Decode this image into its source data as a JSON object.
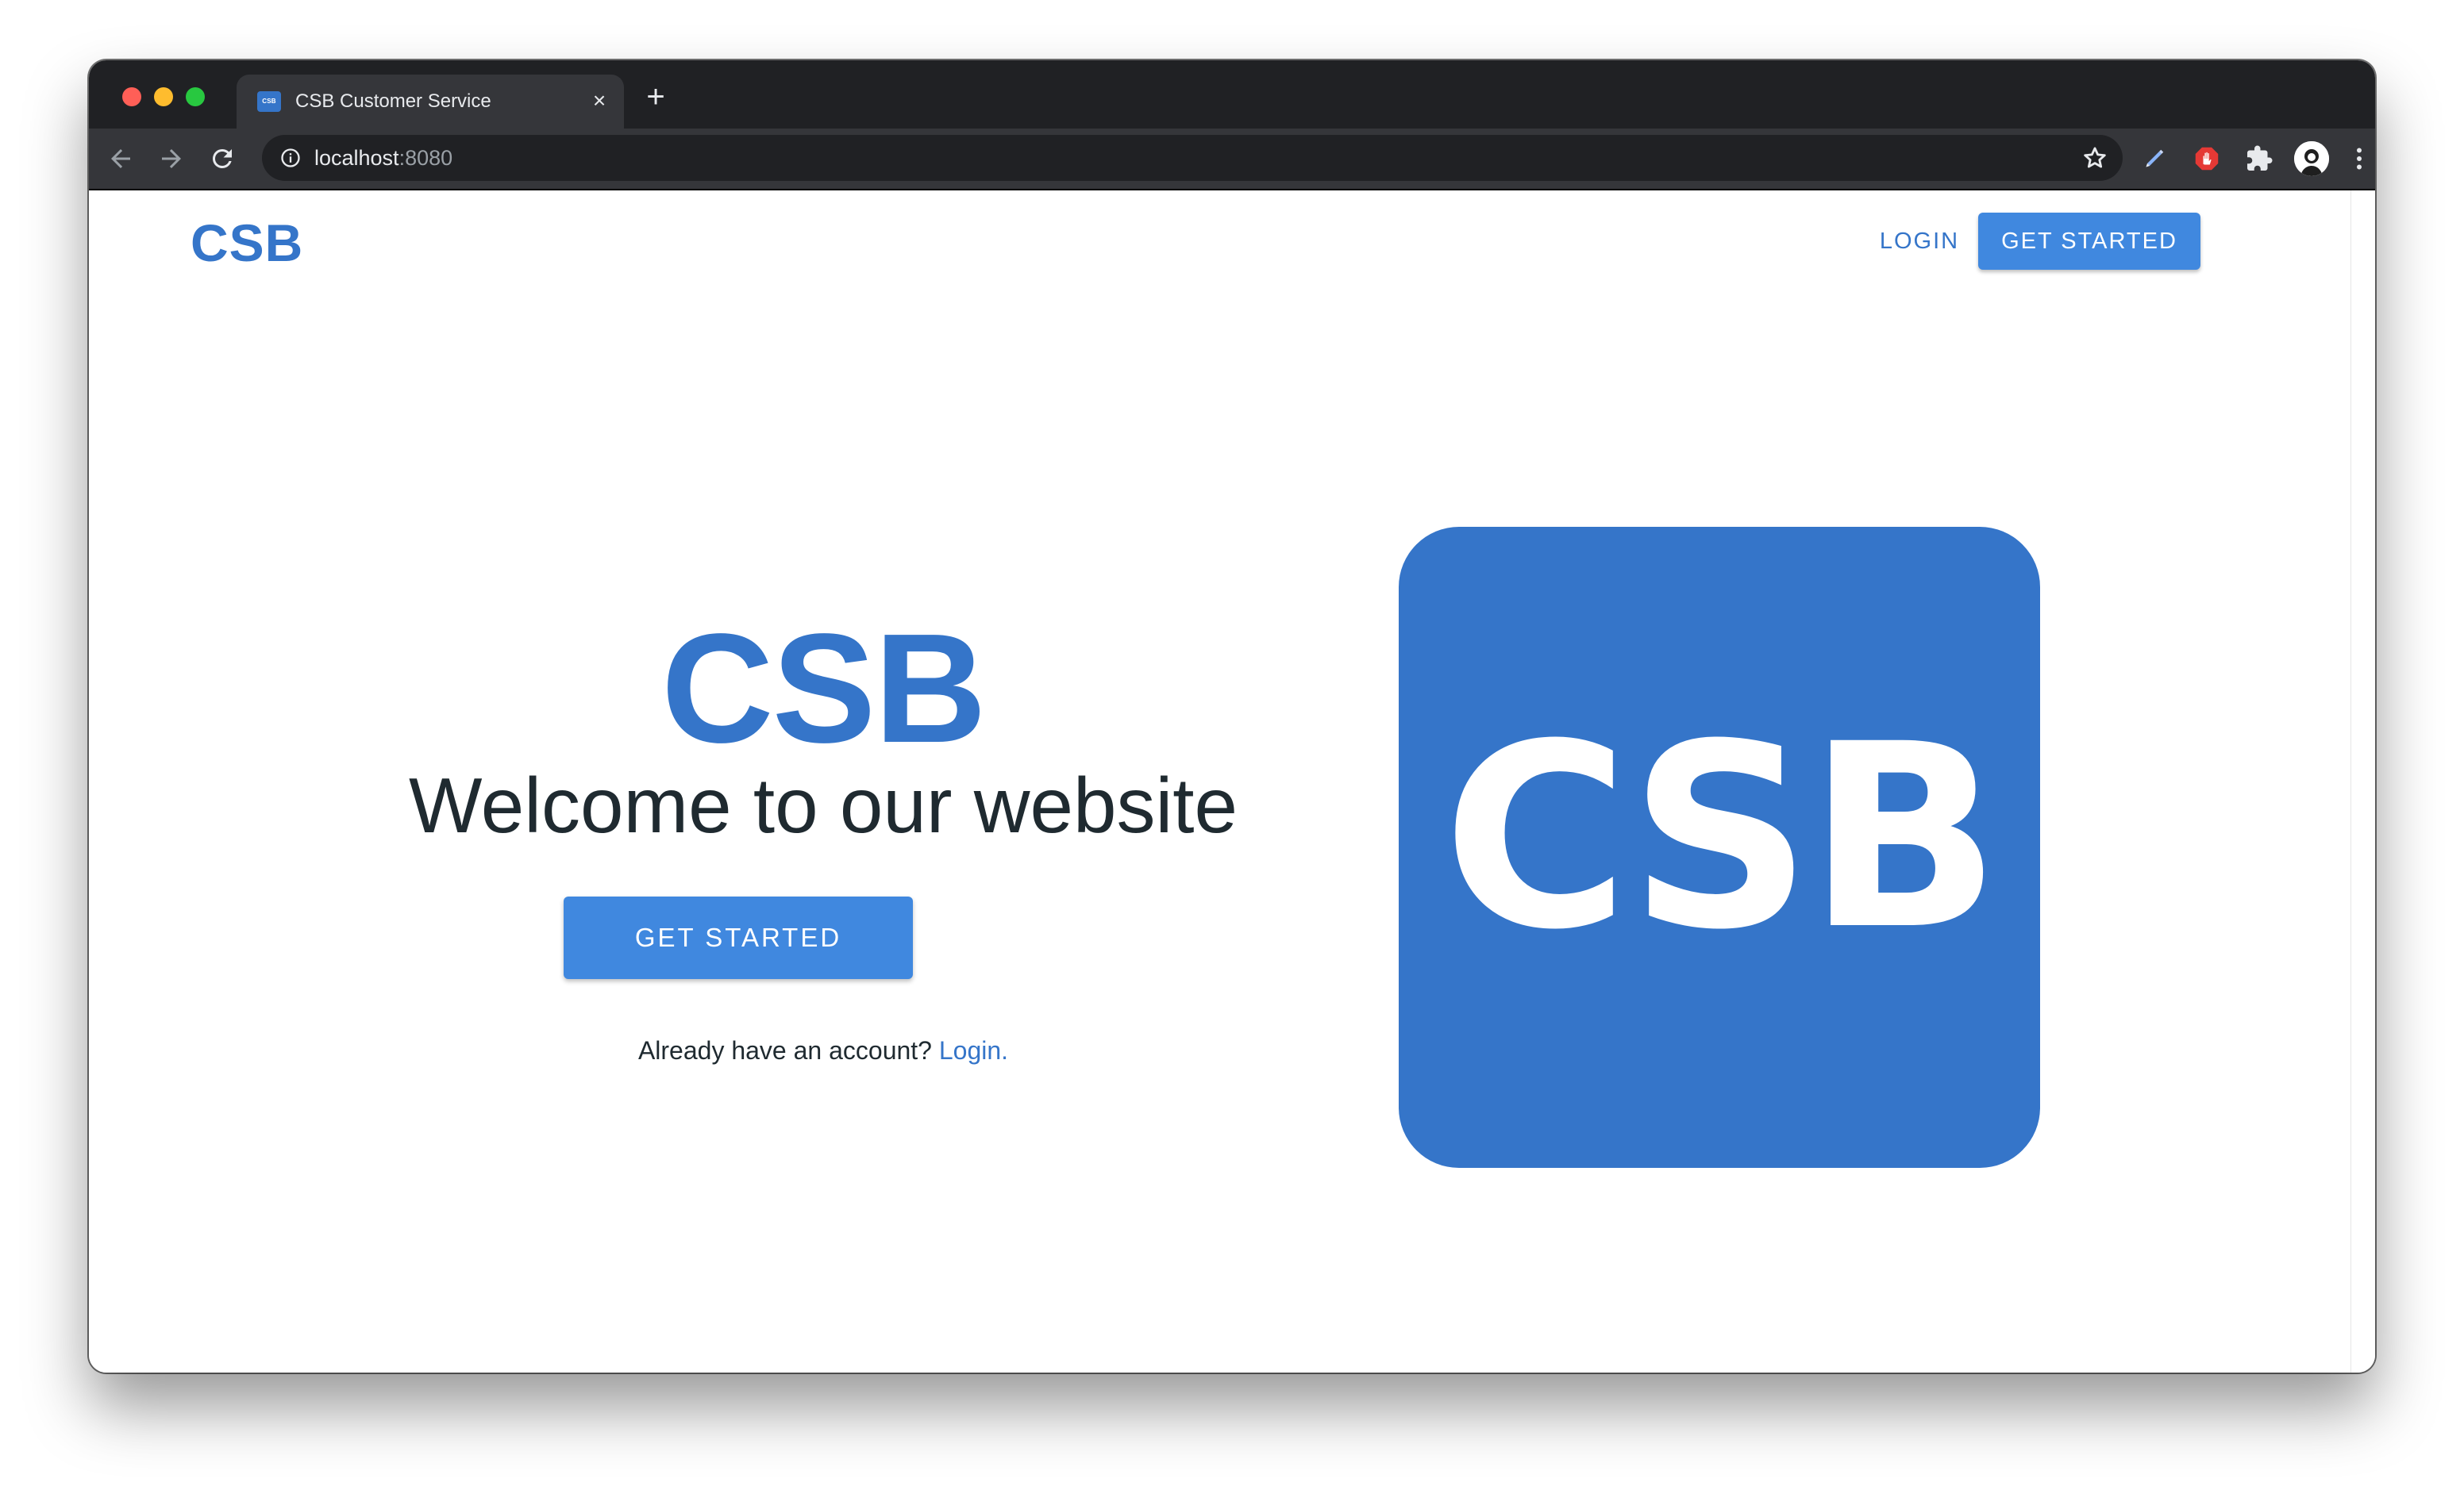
{
  "browser": {
    "tab": {
      "favicon_text": "CSB",
      "title": "CSB Customer Service",
      "close_glyph": "×"
    },
    "new_tab_glyph": "+",
    "url": {
      "host": "localhost",
      "port": ":8080"
    },
    "icons": {
      "back": "arrow-left-icon",
      "forward": "arrow-right-icon",
      "reload": "reload-icon",
      "site_info": "info-icon",
      "bookmark": "star-icon",
      "extensions": [
        "pen-extension-icon",
        "hand-block-extension-icon",
        "puzzle-extensions-icon"
      ],
      "profile": "avatar-icon",
      "menu": "vertical-dots-icon"
    }
  },
  "navbar": {
    "brand": "CSB",
    "login_label": "LOGIN",
    "get_started_label": "GET STARTED"
  },
  "hero": {
    "brand": "CSB",
    "welcome": "Welcome to our website",
    "get_started_label": "GET STARTED",
    "account_prompt": "Already have an account?",
    "login_link": "Login."
  },
  "logo_tile": {
    "text": "CSB"
  },
  "colors": {
    "brand_blue": "#3575c9",
    "button_blue": "#4088df",
    "text_dark": "#1f2a30",
    "chrome_dark": "#202124",
    "chrome_toolbar": "#35363a"
  }
}
